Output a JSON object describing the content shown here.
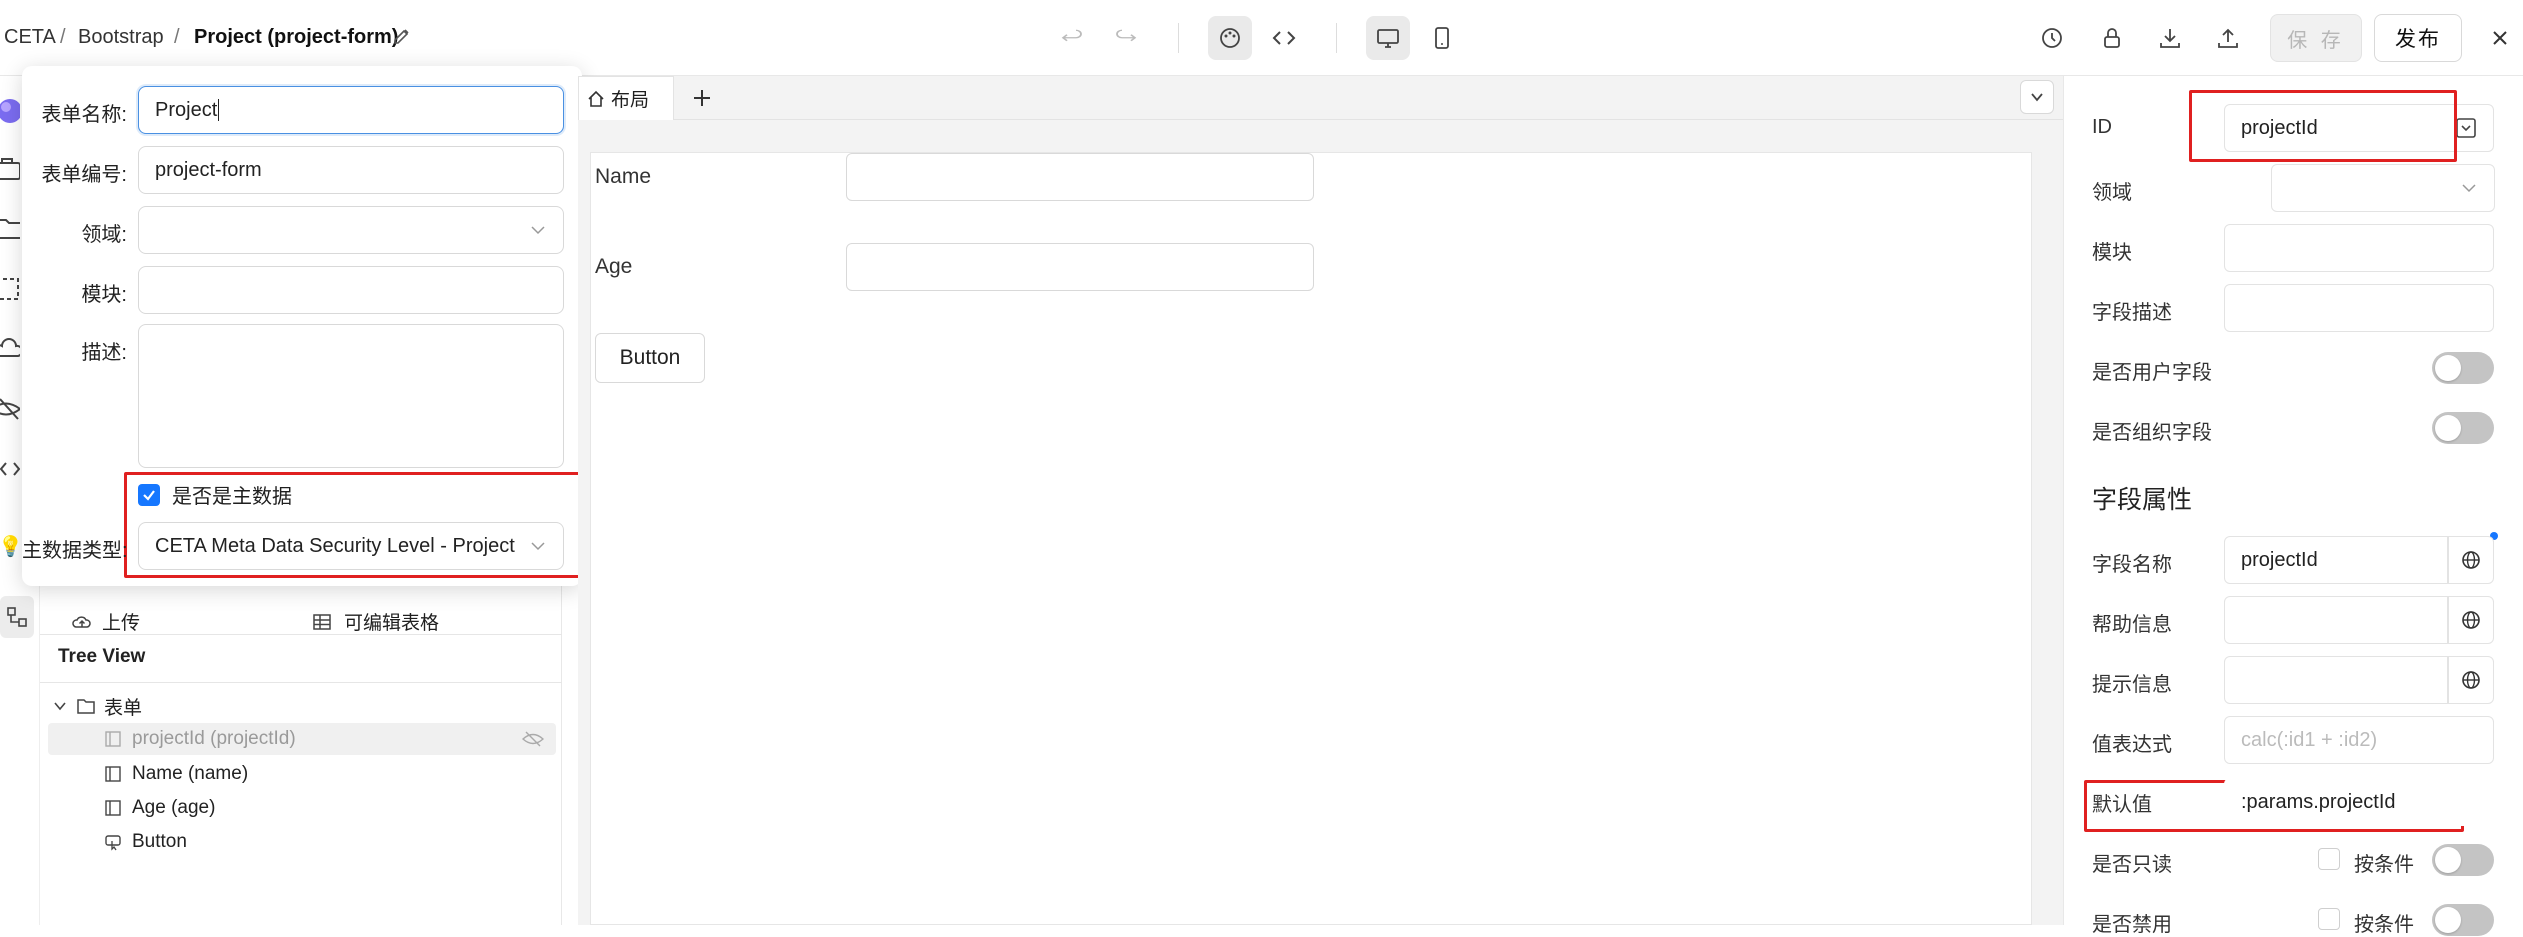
{
  "breadcrumb": {
    "root": "CETA",
    "sep1": "/",
    "level1": "Bootstrap",
    "sep2": "/",
    "current": "Project (project-form)"
  },
  "toolbar": {
    "save_label": "保 存",
    "publish_label": "发布"
  },
  "popover": {
    "form_name_label": "表单名称:",
    "form_name_value": "Project",
    "form_code_label": "表单编号:",
    "form_code_value": "project-form",
    "domain_label": "领域:",
    "module_label": "模块:",
    "desc_label": "描述:",
    "master_data_label": "是否是主数据",
    "master_type_label": "主数据类型:",
    "master_type_value": "CETA Meta Data Security Level - Project"
  },
  "components": {
    "upload": "上传",
    "editable_table": "可编辑表格"
  },
  "tree": {
    "title": "Tree View",
    "root": "表单",
    "items": [
      "projectId (projectId)",
      "Name (name)",
      "Age (age)",
      "Button"
    ]
  },
  "canvas": {
    "tab_label": "布局",
    "fields": [
      {
        "label": "Name"
      },
      {
        "label": "Age"
      }
    ],
    "button_label": "Button"
  },
  "props": {
    "id_label": "ID",
    "id_value": "projectId",
    "domain_label": "领域",
    "module_label": "模块",
    "field_desc_label": "字段描述",
    "is_user_field_label": "是否用户字段",
    "is_org_field_label": "是否组织字段",
    "section_title": "字段属性",
    "field_name_label": "字段名称",
    "field_name_value": "projectId",
    "help_label": "帮助信息",
    "hint_label": "提示信息",
    "value_expr_label": "值表达式",
    "value_expr_placeholder": "calc(:id1 + :id2)",
    "default_label": "默认值",
    "default_value": ":params.projectId",
    "readonly_label": "是否只读",
    "by_condition_label": "按条件",
    "disabled_label": "是否禁用",
    "by_condition_label2": "按条件"
  }
}
